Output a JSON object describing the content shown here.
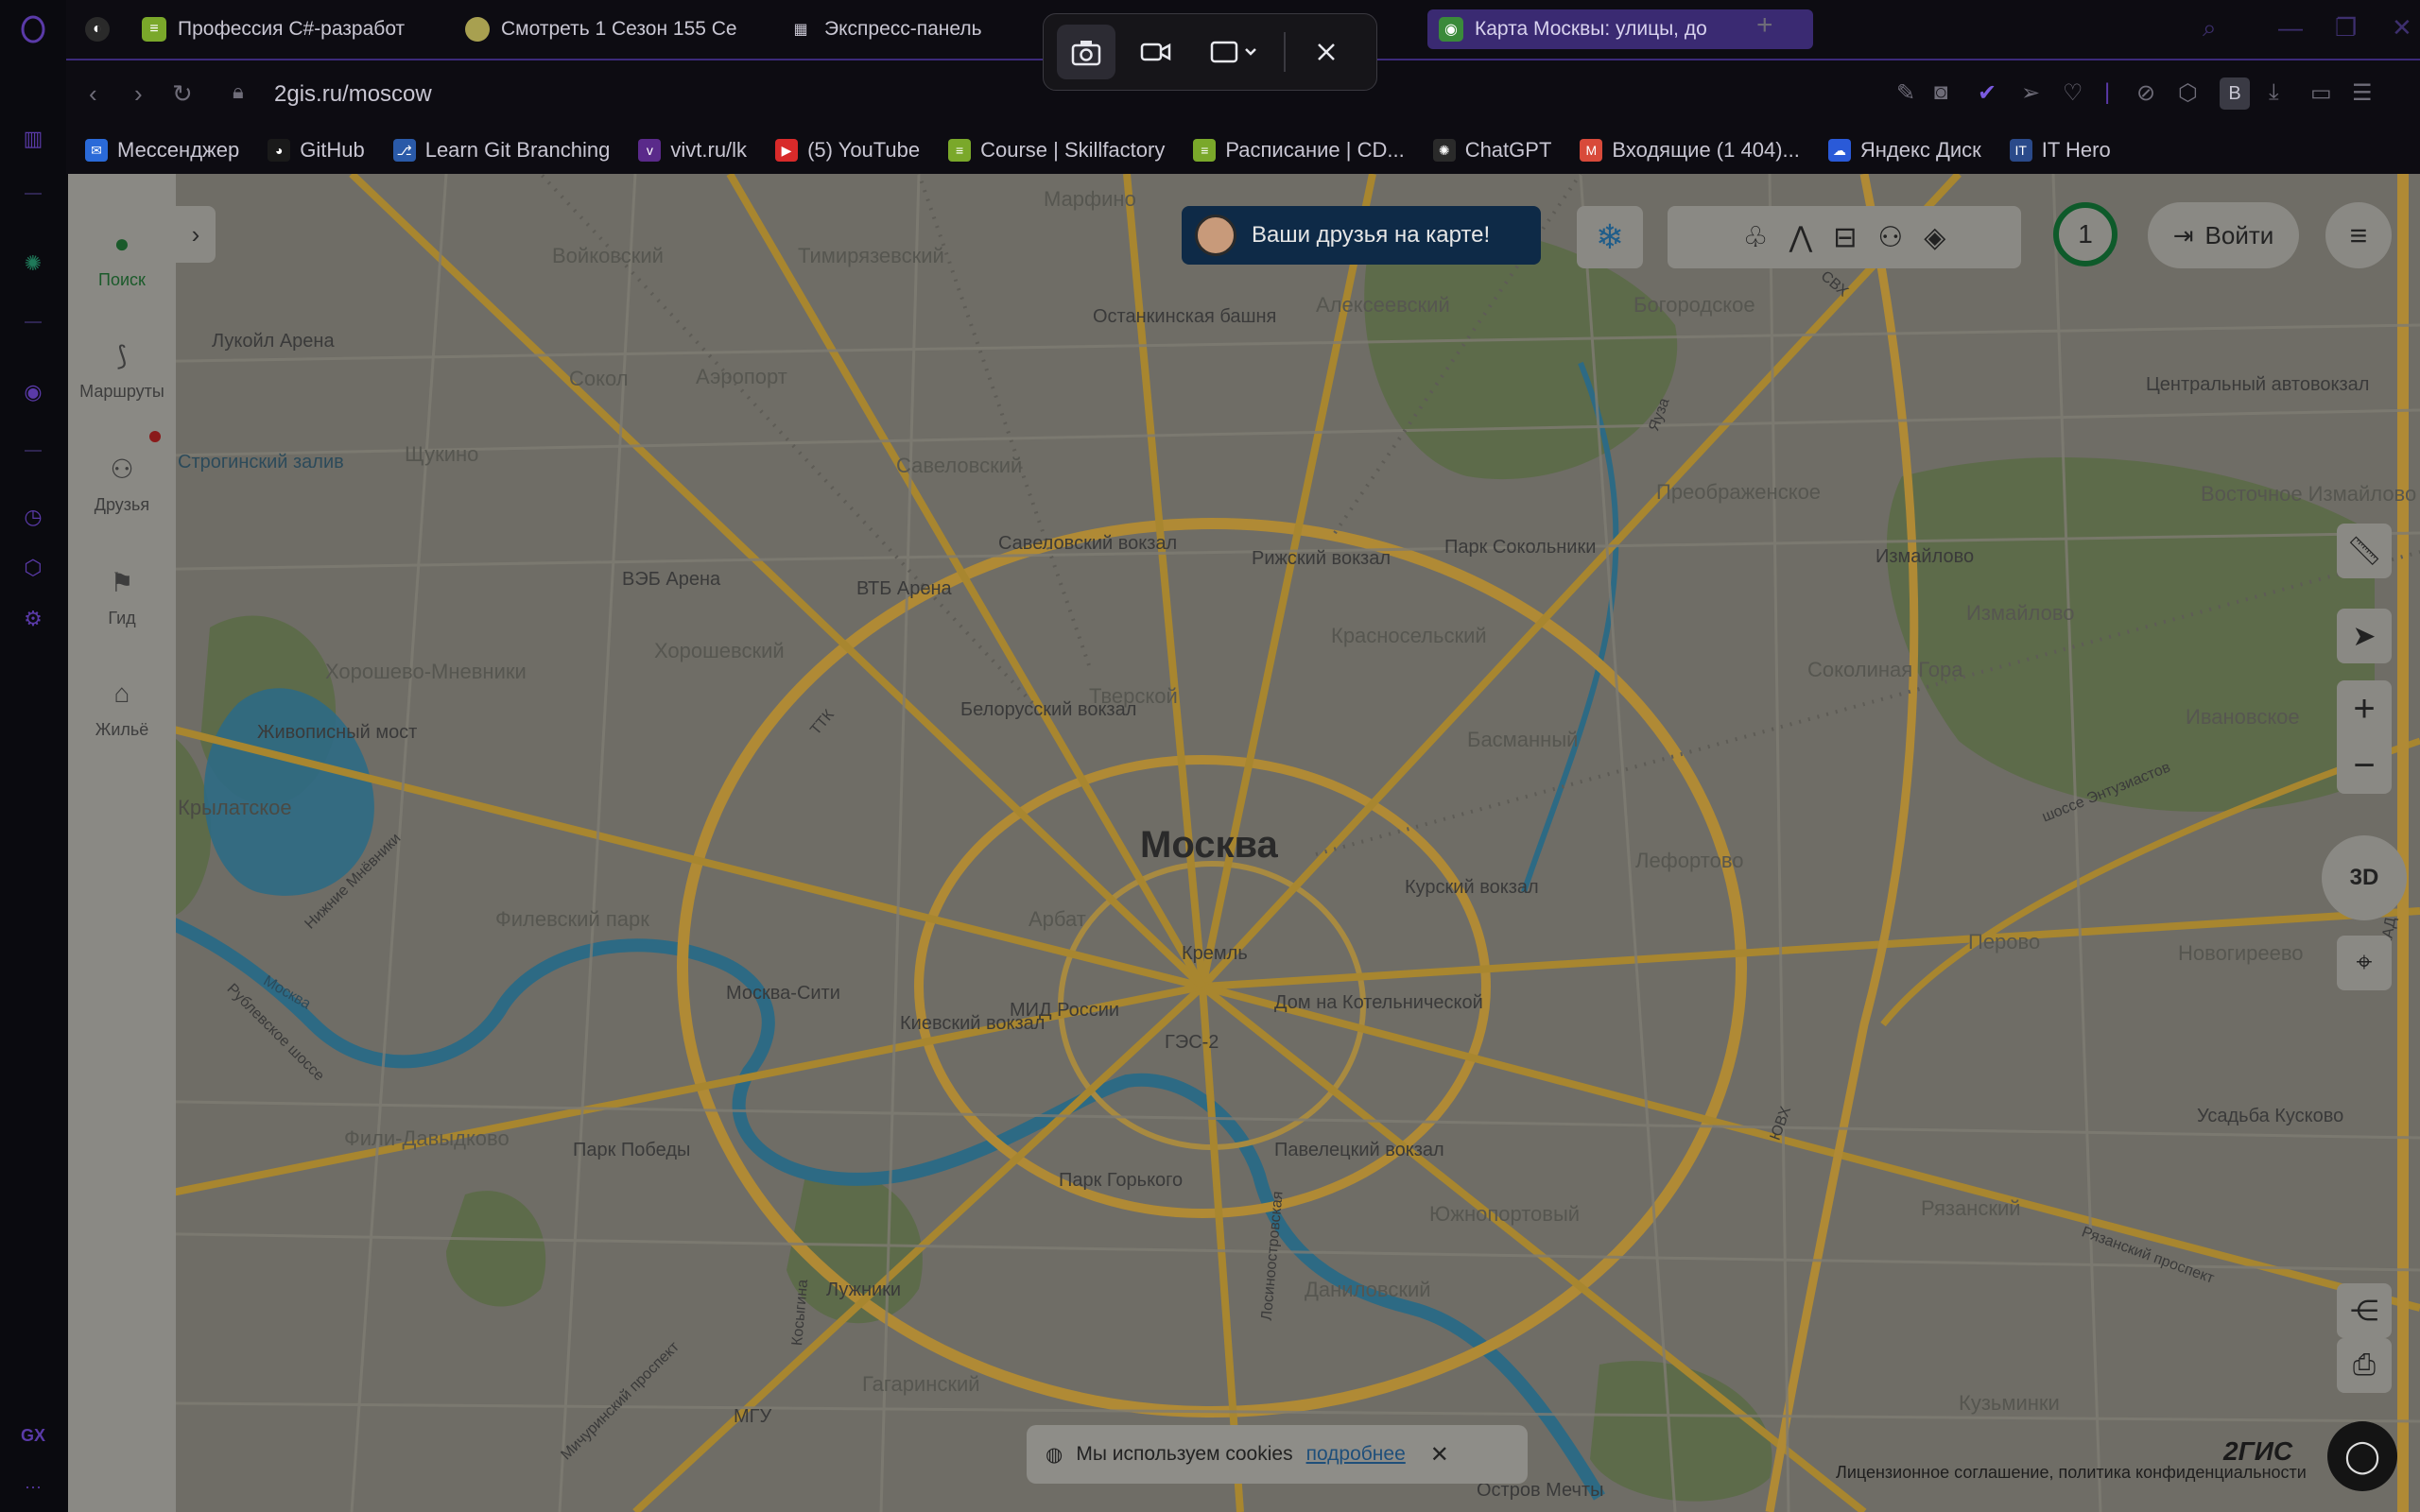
{
  "browser": {
    "tabs": [
      {
        "title": "Профессия C#-разработ",
        "favicon": "skillfactory-icon"
      },
      {
        "title": "Смотреть 1 Сезон 155 Се",
        "favicon": "anime-icon"
      },
      {
        "title": "Экспресс-панель",
        "favicon": "grid-icon"
      },
      {
        "title": "Карта Москвы: улицы, до",
        "favicon": "2gis-icon",
        "active": true
      }
    ],
    "url": "2gis.ru/moscow",
    "bookmarks": [
      {
        "label": "Мессенджер"
      },
      {
        "label": "GitHub"
      },
      {
        "label": "Learn Git Branching"
      },
      {
        "label": "vivt.ru/lk"
      },
      {
        "label": "(5) YouTube"
      },
      {
        "label": "Course | Skillfactory"
      },
      {
        "label": "Расписание | CD..."
      },
      {
        "label": "ChatGPT"
      },
      {
        "label": "Входящие (1 404)..."
      },
      {
        "label": "Яндекс Диск"
      },
      {
        "label": "IT Hero"
      }
    ],
    "profile_letter": "B"
  },
  "gis": {
    "sidebar": [
      {
        "label": "Поиск"
      },
      {
        "label": "Маршруты"
      },
      {
        "label": "Друзья"
      },
      {
        "label": "Гид"
      },
      {
        "label": "Жильё"
      }
    ],
    "friends_banner": "Ваши друзья на карте!",
    "counter": "1",
    "login": "Войти",
    "btn3d": "3D",
    "cookie_text": "Мы используем cookies",
    "cookie_link": "подробнее",
    "legal": "Лицензионное соглашение, политика конфиденциальности",
    "logo": "2ГИС"
  },
  "map_labels": {
    "city": "Москва",
    "districts": [
      "Войковский",
      "Тимирязевский",
      "Марфино",
      "Алексеевский",
      "Богородское",
      "Сокол",
      "Аэропорт",
      "Щукино",
      "Савеловский",
      "Преображенское",
      "Восточное Измайлово",
      "Измайлово",
      "Красносельский",
      "Хорошевский",
      "Хорошево-Мневники",
      "Тверской",
      "Басманный",
      "Соколиная Гора",
      "Ивановское",
      "Лефортово",
      "Филевский парк",
      "Арбат",
      "Перово",
      "Новогиреево",
      "Фили-Давыдково",
      "Южнопортовый",
      "Рязанский",
      "Даниловский",
      "Гагаринский",
      "Кузьминки",
      "Крылатское"
    ],
    "places": [
      "Лукойл Арена",
      "Останкинская башня",
      "Центральный автовокзал",
      "ВЭБ Арена",
      "ВТБ Арена",
      "Савеловский вокзал",
      "Рижский вокзал",
      "Парк Сокольники",
      "Измайлово",
      "Строгинский залив",
      "Белорусский вокзал",
      "Живописный мост",
      "Курский вокзал",
      "Кремль",
      "Москва-Сити",
      "Киевский вокзал",
      "МИД России",
      "Дом на Котельнической",
      "ГЭС-2",
      "Парк Победы",
      "Парк Горького",
      "Павелецкий вокзал",
      "Усадьба Кусково",
      "Лужники",
      "МГУ",
      "Остров Мечты"
    ],
    "roads": [
      "ТТК",
      "Москва",
      "Нижние Мнёвники",
      "Яуза",
      "СВХ",
      "ЮВХ",
      "МКАД",
      "шоссе Энтузиастов",
      "Рязанский проспект",
      "Мичуринский проспект",
      "Косыгина",
      "Лосиноостровская",
      "Рублевское шоссе"
    ]
  },
  "colors": {
    "accent": "#5a3aa8",
    "map_bg": "#6f6d66",
    "road": "#b08a35",
    "water": "#2d6a84",
    "park": "#5a6b45"
  }
}
